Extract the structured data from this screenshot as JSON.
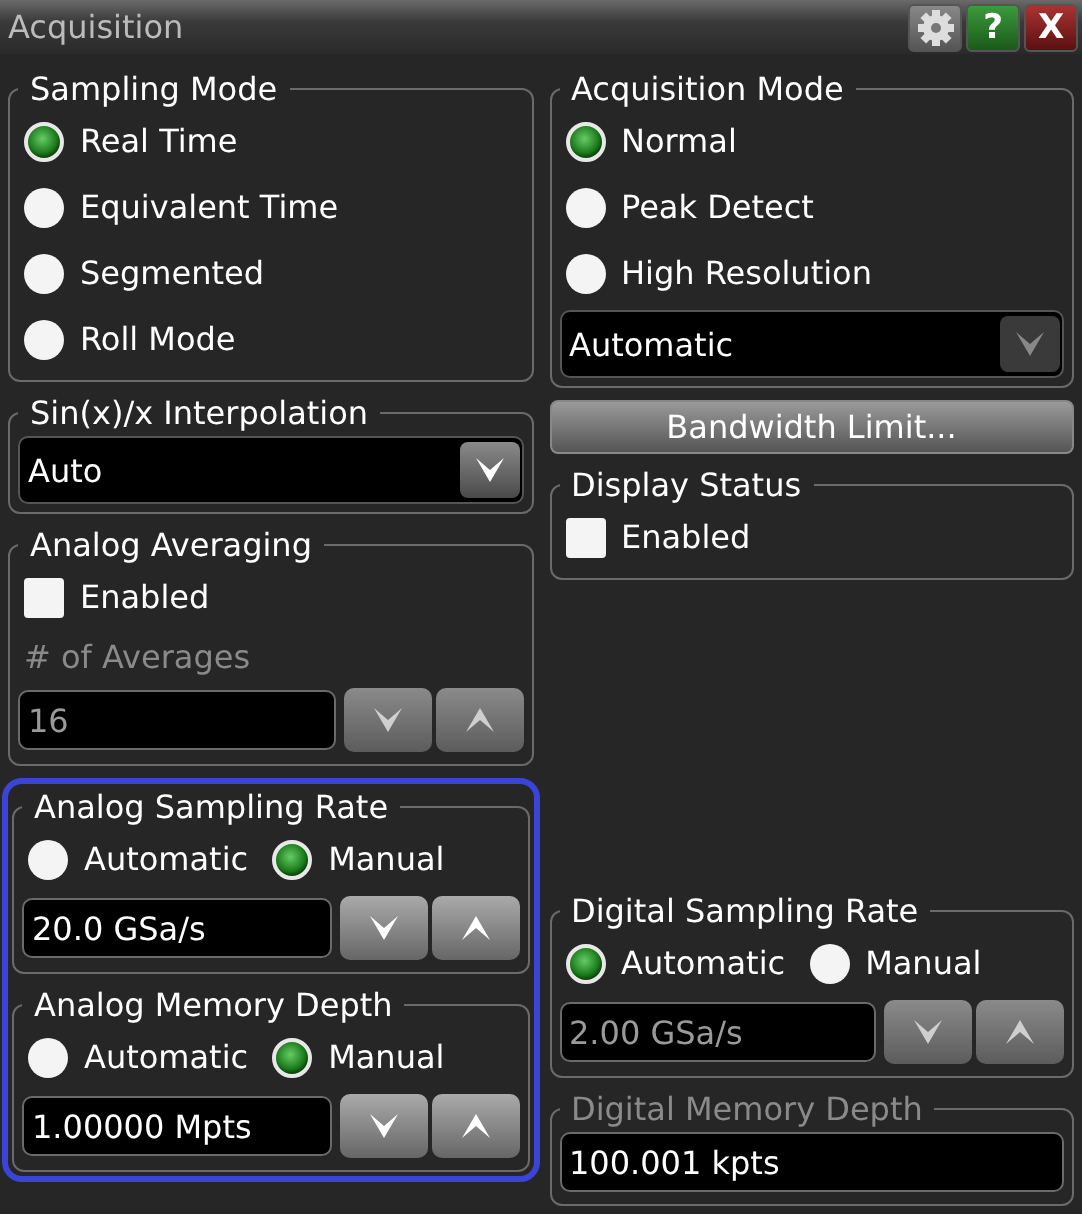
{
  "window": {
    "title": "Acquisition",
    "help_button": "?",
    "close_button": "X"
  },
  "columns": [
    {
      "blocks": [
        {
          "groups": [
            {
              "title": "Sampling Mode",
              "disabled": false,
              "items": [
                {
                  "kind": "radio",
                  "label": "Real Time",
                  "selected": true
                },
                {
                  "kind": "radio",
                  "label": "Equivalent Time",
                  "selected": false
                },
                {
                  "kind": "radio",
                  "label": "Segmented",
                  "selected": false
                },
                {
                  "kind": "radio",
                  "label": "Roll Mode",
                  "selected": false
                }
              ]
            },
            {
              "title": "Sin(x)/x Interpolation",
              "disabled": false,
              "items": [
                {
                  "kind": "select",
                  "value": "Auto",
                  "disabled": false
                }
              ]
            },
            {
              "title": "Analog Averaging",
              "disabled": false,
              "items": [
                {
                  "kind": "checkbox",
                  "label": "Enabled",
                  "checked": false
                },
                {
                  "kind": "caption",
                  "text": "# of Averages",
                  "disabled": true
                },
                {
                  "kind": "spinner",
                  "value": "16",
                  "disabled": true
                }
              ]
            }
          ]
        },
        {
          "highlighted": true,
          "groups": [
            {
              "title": "Analog Sampling Rate",
              "disabled": false,
              "items": [
                {
                  "kind": "radio_row",
                  "options": [
                    {
                      "label": "Automatic",
                      "selected": false
                    },
                    {
                      "label": "Manual",
                      "selected": true
                    }
                  ]
                },
                {
                  "kind": "spinner",
                  "value": "20.0 GSa/s",
                  "disabled": false
                }
              ]
            },
            {
              "title": "Analog Memory Depth",
              "disabled": false,
              "items": [
                {
                  "kind": "radio_row",
                  "options": [
                    {
                      "label": "Automatic",
                      "selected": false
                    },
                    {
                      "label": "Manual",
                      "selected": true
                    }
                  ]
                },
                {
                  "kind": "spinner",
                  "value": "1.00000 Mpts",
                  "disabled": false
                }
              ]
            }
          ]
        }
      ]
    },
    {
      "blocks": [
        {
          "groups": [
            {
              "title": "Acquisition Mode",
              "disabled": false,
              "items": [
                {
                  "kind": "radio",
                  "label": "Normal",
                  "selected": true
                },
                {
                  "kind": "radio",
                  "label": "Peak Detect",
                  "selected": false
                },
                {
                  "kind": "radio",
                  "label": "High Resolution",
                  "selected": false
                },
                {
                  "kind": "select",
                  "value": "Automatic",
                  "disabled": true
                }
              ]
            },
            {
              "kind": "button",
              "label": "Bandwidth Limit..."
            },
            {
              "title": "Display Status",
              "disabled": false,
              "items": [
                {
                  "kind": "checkbox",
                  "label": "Enabled",
                  "checked": false
                }
              ]
            }
          ]
        },
        {
          "groups": [
            {
              "title": "Digital Sampling Rate",
              "disabled": false,
              "items": [
                {
                  "kind": "radio_row",
                  "options": [
                    {
                      "label": "Automatic",
                      "selected": true
                    },
                    {
                      "label": "Manual",
                      "selected": false
                    }
                  ]
                },
                {
                  "kind": "spinner",
                  "value": "2.00 GSa/s",
                  "disabled": true
                }
              ]
            },
            {
              "title": "Digital Memory Depth",
              "disabled": true,
              "items": [
                {
                  "kind": "field",
                  "value": "100.001 kpts",
                  "disabled": false
                }
              ]
            }
          ]
        }
      ]
    }
  ]
}
